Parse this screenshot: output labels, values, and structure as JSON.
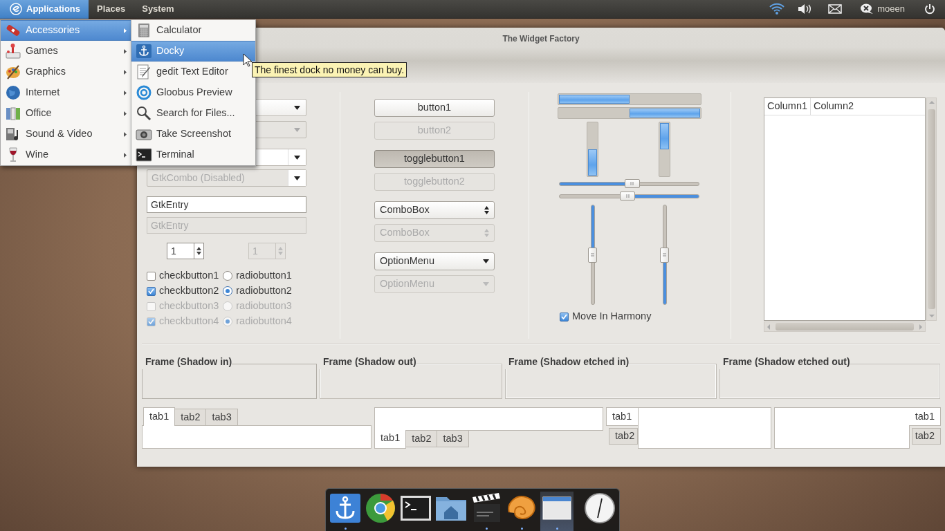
{
  "panel": {
    "menus": [
      {
        "label": "Applications",
        "selected": true
      },
      {
        "label": "Places",
        "selected": false
      },
      {
        "label": "System",
        "selected": false
      }
    ],
    "user": "moeen"
  },
  "applications_menu": [
    {
      "label": "Accessories",
      "selected": true
    },
    {
      "label": "Games",
      "selected": false
    },
    {
      "label": "Graphics",
      "selected": false
    },
    {
      "label": "Internet",
      "selected": false
    },
    {
      "label": "Office",
      "selected": false
    },
    {
      "label": "Sound & Video",
      "selected": false
    },
    {
      "label": "Wine",
      "selected": false
    }
  ],
  "accessories_menu": [
    {
      "label": "Calculator",
      "selected": false
    },
    {
      "label": "Docky",
      "selected": true
    },
    {
      "label": "gedit Text Editor",
      "selected": false
    },
    {
      "label": "Gloobus Preview",
      "selected": false
    },
    {
      "label": "Search for Files...",
      "selected": false
    },
    {
      "label": "Take Screenshot",
      "selected": false
    },
    {
      "label": "Terminal",
      "selected": false
    }
  ],
  "tooltip": "The finest dock no money can buy.",
  "window": {
    "title": "The Widget Factory",
    "combos": [
      {
        "kind": "combo",
        "disabled": false
      },
      {
        "kind": "combo",
        "disabled": true
      },
      {
        "kind": "combo-entry",
        "disabled": false
      },
      {
        "kind": "combo-entry",
        "disabled": true,
        "value": "GtkCombo (Disabled)"
      }
    ],
    "entries": [
      {
        "value": "GtkEntry",
        "disabled": false
      },
      {
        "value": "GtkEntry",
        "disabled": true
      }
    ],
    "spin_buttons": [
      {
        "value": "1",
        "disabled": false
      },
      {
        "value": "1",
        "disabled": true
      }
    ],
    "check_buttons": [
      {
        "label": "checkbutton1",
        "checked": false,
        "disabled": false
      },
      {
        "label": "checkbutton2",
        "checked": true,
        "disabled": false
      },
      {
        "label": "checkbutton3",
        "checked": false,
        "disabled": true
      },
      {
        "label": "checkbutton4",
        "checked": true,
        "disabled": true
      }
    ],
    "radio_buttons": [
      {
        "label": "radiobutton1",
        "selected": false,
        "disabled": false
      },
      {
        "label": "radiobutton2",
        "selected": true,
        "disabled": false
      },
      {
        "label": "radiobutton3",
        "selected": false,
        "disabled": true
      },
      {
        "label": "radiobutton4",
        "selected": true,
        "disabled": true
      }
    ],
    "buttons": [
      {
        "kind": "button",
        "label": "button1",
        "disabled": false,
        "pressed": false
      },
      {
        "kind": "button",
        "label": "button2",
        "disabled": true,
        "pressed": false
      },
      {
        "kind": "toggle",
        "label": "togglebutton1",
        "disabled": false,
        "pressed": true
      },
      {
        "kind": "toggle",
        "label": "togglebutton2",
        "disabled": true,
        "pressed": false
      },
      {
        "kind": "combobox",
        "label": "ComboBox",
        "disabled": false,
        "pressed": false
      },
      {
        "kind": "combobox",
        "label": "ComboBox",
        "disabled": true,
        "pressed": false
      },
      {
        "kind": "option-menu",
        "label": "OptionMenu",
        "disabled": false,
        "pressed": false
      },
      {
        "kind": "option-menu",
        "label": "OptionMenu",
        "disabled": true,
        "pressed": false
      }
    ],
    "progress_bars": [
      {
        "kind": "left-to-right",
        "level": 0.5
      },
      {
        "kind": "right-to-left",
        "level": 0.5
      },
      {
        "kind": "bottom-to-top",
        "level": 0.5
      },
      {
        "kind": "top-to-bottom",
        "level": 0.5
      }
    ],
    "scales": [
      {
        "kind": "horizontal",
        "inverted": false,
        "level": 0.52
      },
      {
        "kind": "horizontal",
        "inverted": true,
        "level": 0.51
      },
      {
        "kind": "vertical",
        "inverted": false,
        "level": 0.5
      },
      {
        "kind": "vertical",
        "inverted": true,
        "level": 0.5
      }
    ],
    "move_in_harmony": {
      "label": "Move In Harmony",
      "checked": true
    },
    "tree": {
      "columns": [
        "Column1",
        "Column2"
      ]
    },
    "frames": [
      {
        "label": "Frame (Shadow in)",
        "kind": "in"
      },
      {
        "label": "Frame (Shadow out)",
        "kind": "out"
      },
      {
        "label": "Frame (Shadow etched in)",
        "kind": "etched-in"
      },
      {
        "label": "Frame (Shadow etched out)",
        "kind": "etched-out"
      }
    ],
    "notebooks": [
      {
        "kind": "top",
        "tabs": [
          {
            "label": "tab1",
            "selected": true
          },
          {
            "label": "tab2",
            "selected": false
          },
          {
            "label": "tab3",
            "selected": false
          }
        ]
      },
      {
        "kind": "bottom",
        "tabs": [
          {
            "label": "tab1",
            "selected": true
          },
          {
            "label": "tab2",
            "selected": false
          },
          {
            "label": "tab3",
            "selected": false
          }
        ]
      },
      {
        "kind": "left",
        "tabs": [
          {
            "label": "tab1",
            "selected": true
          },
          {
            "label": "tab2",
            "selected": false
          }
        ]
      },
      {
        "kind": "right",
        "tabs": [
          {
            "label": "tab1",
            "selected": true
          },
          {
            "label": "tab2",
            "selected": false
          }
        ]
      }
    ]
  },
  "dock": [
    {
      "running": true,
      "selected": false
    },
    {
      "running": false,
      "selected": false
    },
    {
      "running": false,
      "selected": false
    },
    {
      "running": false,
      "selected": false
    },
    {
      "running": true,
      "selected": false
    },
    {
      "running": true,
      "selected": false
    },
    {
      "running": true,
      "selected": true
    },
    {
      "running": false,
      "selected": false
    }
  ]
}
